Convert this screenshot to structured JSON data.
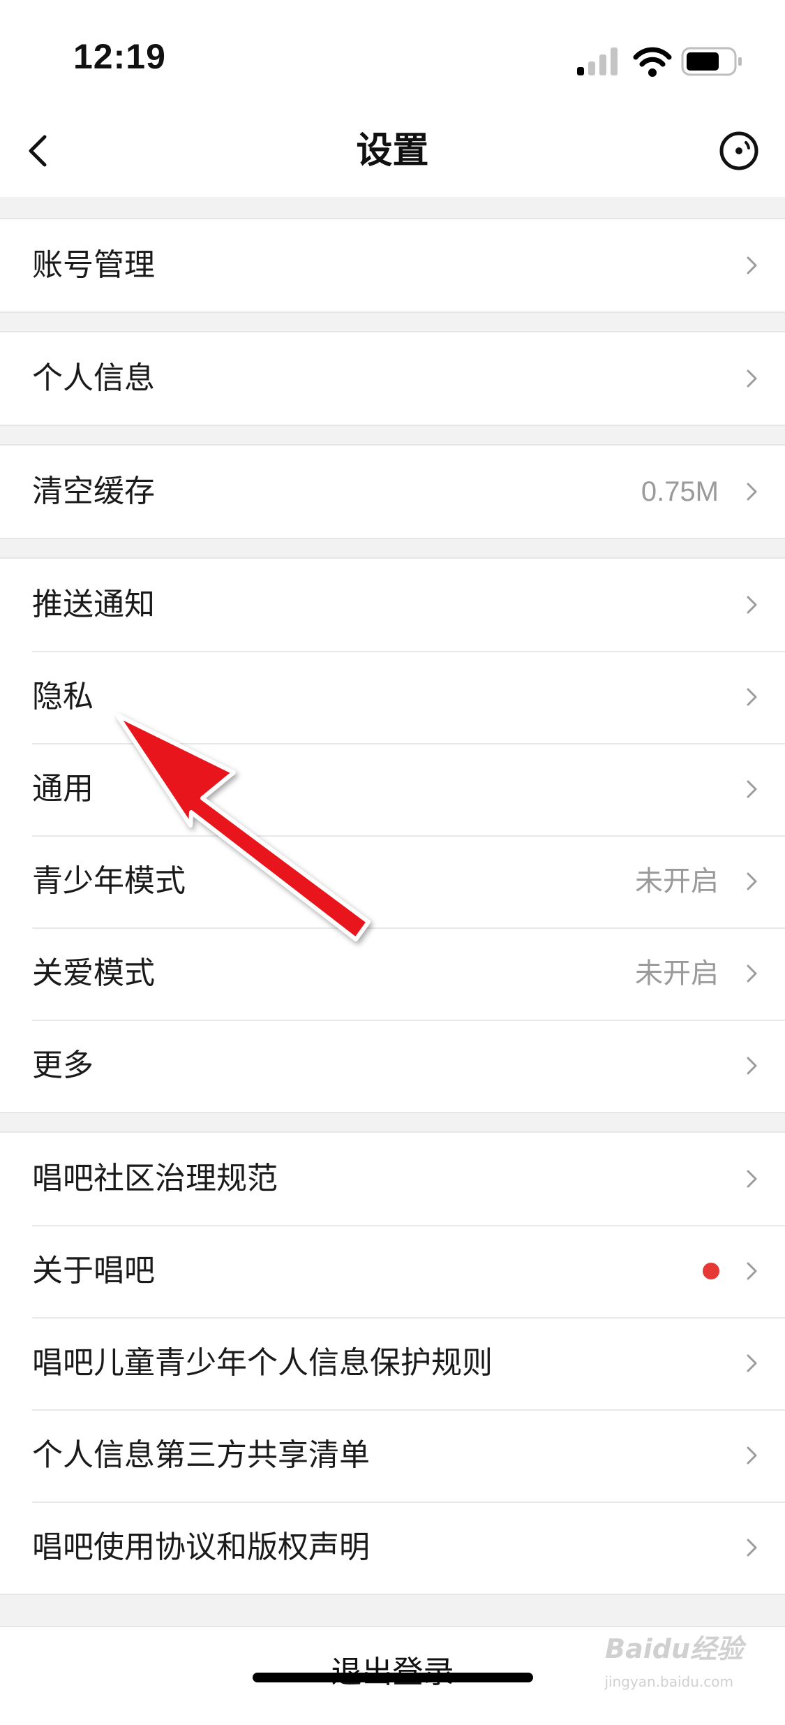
{
  "status_bar": {
    "time": "12:19"
  },
  "header": {
    "title": "设置"
  },
  "groups": [
    {
      "items": [
        {
          "label": "账号管理"
        }
      ]
    },
    {
      "items": [
        {
          "label": "个人信息"
        }
      ]
    },
    {
      "items": [
        {
          "label": "清空缓存",
          "value": "0.75M"
        }
      ]
    },
    {
      "items": [
        {
          "label": "推送通知"
        },
        {
          "label": "隐私"
        },
        {
          "label": "通用"
        },
        {
          "label": "青少年模式",
          "value": "未开启"
        },
        {
          "label": "关爱模式",
          "value": "未开启"
        },
        {
          "label": "更多"
        }
      ]
    },
    {
      "items": [
        {
          "label": "唱吧社区治理规范"
        },
        {
          "label": "关于唱吧",
          "badge": "red-dot"
        },
        {
          "label": "唱吧儿童青少年个人信息保护规则"
        },
        {
          "label": "个人信息第三方共享清单"
        },
        {
          "label": "唱吧使用协议和版权声明"
        }
      ]
    }
  ],
  "logout": {
    "label": "退出登录"
  },
  "watermark": {
    "text": "Baidu经验",
    "sub": "jingyan.baidu.com"
  },
  "colors": {
    "annotation_arrow": "#e8141b",
    "badge": "#e53935"
  }
}
